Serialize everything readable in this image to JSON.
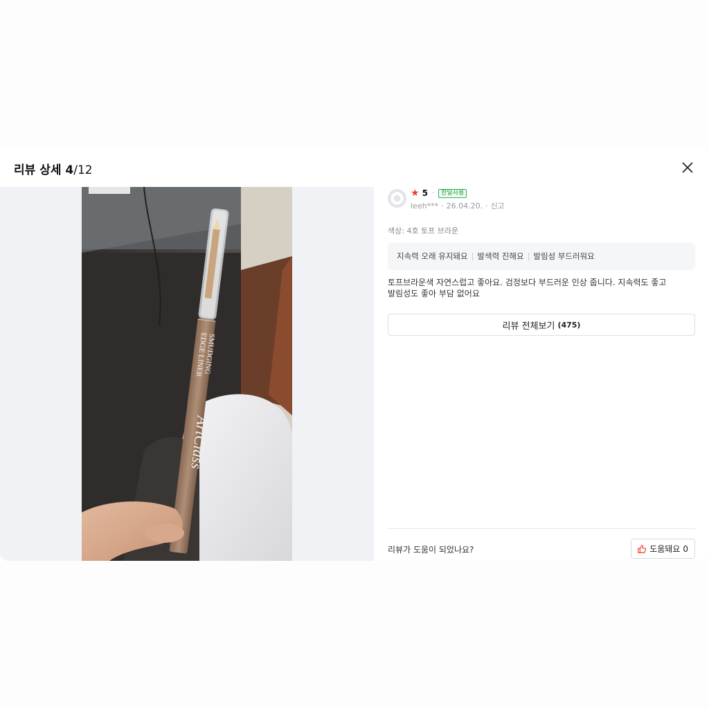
{
  "modal": {
    "title_prefix": "리뷰 상세 ",
    "index": "4",
    "total": "/12"
  },
  "review": {
    "rating": "5",
    "badge": "한달사용",
    "author": "leeh***",
    "date": "26.04.20.",
    "report": "신고",
    "option": "색상: 4호 토프 브라운",
    "tags": [
      "지속력 오래 유지돼요",
      "발색력 진해요",
      "발림성 부드러워요"
    ],
    "body": "토프브라운색 자연스럽고 좋아요. 검정보다 부드러운 인상 줍니다. 지속력도 좋고\n발림성도 좋아 부담 없어요"
  },
  "all_reviews": {
    "label": "리뷰 전체보기",
    "count": "(475)"
  },
  "helpful": {
    "question": "리뷰가 도움이 되었나요?",
    "label": "도움돼요",
    "count": "0"
  },
  "product_photo": {
    "line1": "SMUDGING",
    "line2": "EDGE LINER",
    "brand": "ArtClass"
  },
  "colors": {
    "star": "#f03a2c",
    "badge": "#2fb350"
  },
  "icons": [
    "close-icon",
    "star-icon",
    "thumbs-up-icon",
    "avatar-placeholder-icon"
  ]
}
